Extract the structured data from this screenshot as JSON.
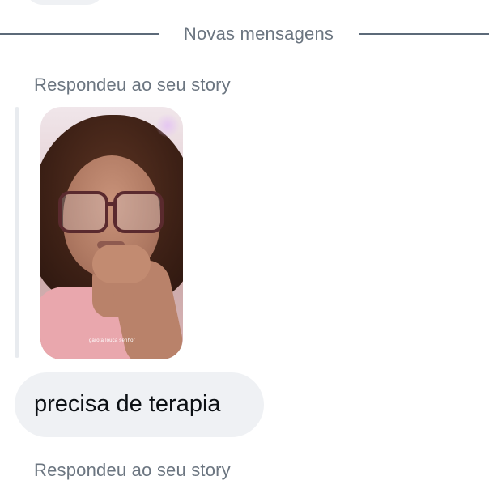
{
  "thread": {
    "divider_label": "Novas mensagens",
    "story_reply_label_1": "Respondeu ao seu story",
    "story_caption": "garota louca senhor",
    "message_text": "precisa de terapia",
    "story_reply_label_2": "Respondeu ao seu story"
  },
  "colors": {
    "background": "#ffffff",
    "bubble": "#eff1f4",
    "secondary_text": "#6b7580",
    "primary_text": "#0c1014",
    "divider": "#5c6a79"
  }
}
